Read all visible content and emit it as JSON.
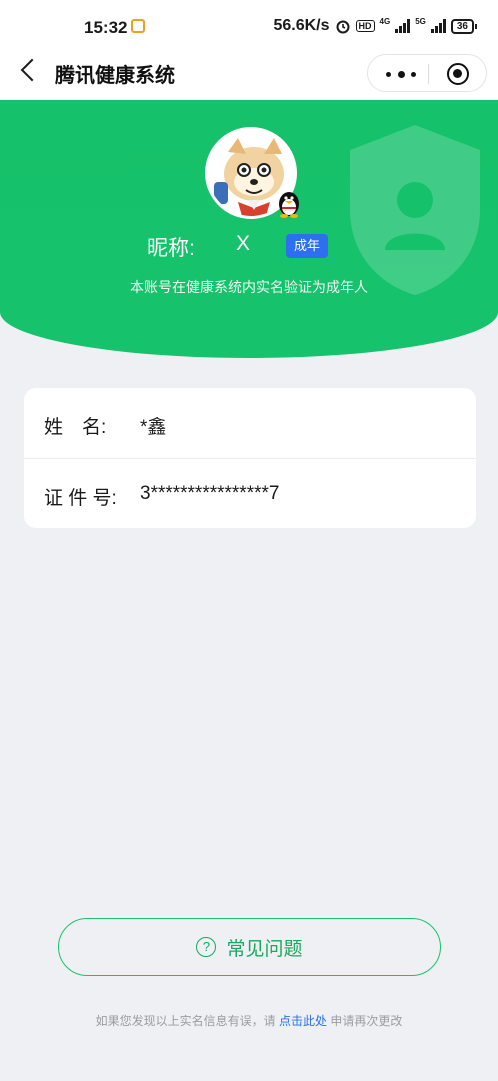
{
  "status_bar": {
    "time": "15:32",
    "network_speed": "56.6K/s",
    "hd_label": "HD",
    "net_4g": "4G",
    "net_5g": "5G",
    "battery": "36"
  },
  "nav": {
    "title": "腾讯健康系统"
  },
  "profile": {
    "nickname_label": "昵称:",
    "nickname_value": "X",
    "badge": "成年",
    "verify_text": "本账号在健康系统内实名验证为成年人"
  },
  "info": {
    "name_label": "姓　名:",
    "name_value": "*鑫",
    "id_label": "证 件 号:",
    "id_value": "3****************7"
  },
  "faq": {
    "label": "常见问题",
    "icon_glyph": "?"
  },
  "footer": {
    "prefix": "如果您发现以上实名信息有误，请 ",
    "link": "点击此处",
    "suffix": " 申请再次更改"
  },
  "colors": {
    "primary_green": "#17c26c",
    "badge_blue": "#2d6ff0",
    "link_blue": "#2a6ff0",
    "page_bg": "#eef0f4"
  }
}
